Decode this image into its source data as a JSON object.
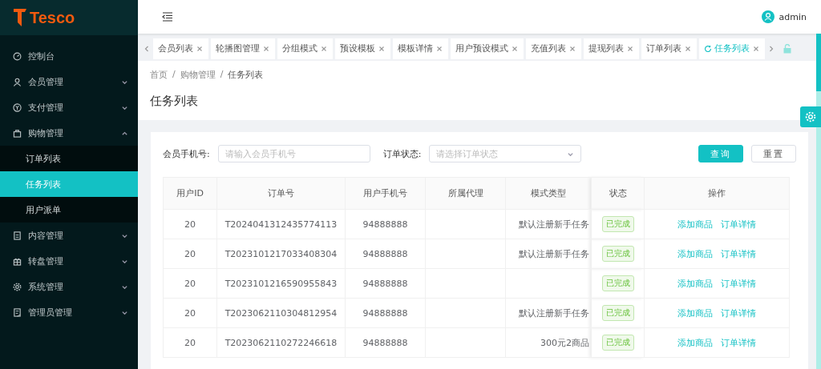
{
  "sidebar": {
    "logo": "Tesco",
    "items": [
      {
        "label": "控制台",
        "kind": "link"
      },
      {
        "label": "会员管理",
        "kind": "group",
        "expanded": false
      },
      {
        "label": "支付管理",
        "kind": "group",
        "expanded": false
      },
      {
        "label": "购物管理",
        "kind": "group",
        "expanded": true,
        "children": [
          {
            "label": "订单列表",
            "selected": false
          },
          {
            "label": "任务列表",
            "selected": true
          },
          {
            "label": "用户派单",
            "selected": false
          }
        ]
      },
      {
        "label": "内容管理",
        "kind": "group",
        "expanded": false
      },
      {
        "label": "转盘管理",
        "kind": "group",
        "expanded": false
      },
      {
        "label": "系统管理",
        "kind": "group",
        "expanded": false
      },
      {
        "label": "管理员管理",
        "kind": "group",
        "expanded": false
      }
    ]
  },
  "header": {
    "user": "admin"
  },
  "tabs": [
    {
      "label": "会员列表",
      "selected": false
    },
    {
      "label": "轮播图管理",
      "selected": false
    },
    {
      "label": "分组模式",
      "selected": false
    },
    {
      "label": "预设模板",
      "selected": false
    },
    {
      "label": "模板详情",
      "selected": false
    },
    {
      "label": "用户预设模式",
      "selected": false
    },
    {
      "label": "充值列表",
      "selected": false
    },
    {
      "label": "提现列表",
      "selected": false
    },
    {
      "label": "订单列表",
      "selected": false
    },
    {
      "label": "任务列表",
      "selected": true
    }
  ],
  "breadcrumb": [
    "首页",
    "购物管理",
    "任务列表"
  ],
  "breadcrumb_separator": "/",
  "page_title": "任务列表",
  "filters": [
    {
      "label": "会员手机号:",
      "kind": "input",
      "placeholder": "请输入会员手机号"
    },
    {
      "label": "订单状态:",
      "kind": "select",
      "placeholder": "请选择订单状态"
    }
  ],
  "buttons": [
    {
      "label": "查询",
      "kind": "primary"
    },
    {
      "label": "重置",
      "kind": "default"
    }
  ],
  "table": {
    "columns": [
      "用户ID",
      "订单号",
      "用户手机号",
      "所属代理",
      "模式类型",
      "状态",
      "操作"
    ],
    "rows": [
      {
        "user_id": "20",
        "order_no": "T2024041312435774113",
        "phone": "94888888",
        "mode": "默认注册新手任务",
        "status": "已完成",
        "actions": [
          "添加商品",
          "订单详情"
        ]
      },
      {
        "user_id": "20",
        "order_no": "T2023101217033408304",
        "phone": "94888888",
        "mode": "默认注册新手任务",
        "status": "已完成",
        "actions": [
          "添加商品",
          "订单详情"
        ]
      },
      {
        "user_id": "20",
        "order_no": "T2023101216590955843",
        "phone": "94888888",
        "status": "已完成",
        "actions": [
          "添加商品",
          "订单详情"
        ]
      },
      {
        "user_id": "20",
        "order_no": "T2023062110304812954",
        "phone": "94888888",
        "mode": "默认注册新手任务",
        "status": "已完成",
        "actions": [
          "添加商品",
          "订单详情"
        ]
      },
      {
        "user_id": "20",
        "order_no": "T2023062110272246618",
        "phone": "94888888",
        "mode": "300元2商品",
        "status": "已完成",
        "actions": [
          "添加商品",
          "订单详情"
        ]
      }
    ]
  }
}
